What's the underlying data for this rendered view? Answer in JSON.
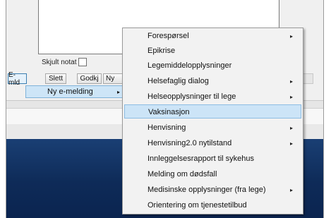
{
  "form": {
    "hidden_note_label": "Skjult notat"
  },
  "toolbar": {
    "buttons": [
      "E-mld",
      "Slett",
      "Godkj",
      "Ny"
    ]
  },
  "submenu": {
    "label": "Ny e-melding",
    "arrow": "▸"
  },
  "context_menu": {
    "items": [
      {
        "label": "Forespørsel",
        "arrow": "▸"
      },
      {
        "label": "Epikrise",
        "arrow": ""
      },
      {
        "label": "Legemiddelopplysninger",
        "arrow": ""
      },
      {
        "label": "Helsefaglig dialog",
        "arrow": "▸"
      },
      {
        "label": "Helseopplysninger til lege",
        "arrow": "▸"
      },
      {
        "label": "Vaksinasjon",
        "arrow": ""
      },
      {
        "label": "Henvisning",
        "arrow": "▸"
      },
      {
        "label": "Henvisning2.0 nytilstand",
        "arrow": "▸"
      },
      {
        "label": "Innleggelsesrapport til sykehus",
        "arrow": ""
      },
      {
        "label": "Melding om dødsfall",
        "arrow": ""
      },
      {
        "label": "Medisinske opplysninger (fra lege)",
        "arrow": "▸"
      },
      {
        "label": "Orientering om tjenestetilbud",
        "arrow": ""
      }
    ],
    "highlighted_index": 5
  },
  "colors": {
    "highlight": "#cce4f7",
    "navy_panel": "#0e2b58"
  }
}
